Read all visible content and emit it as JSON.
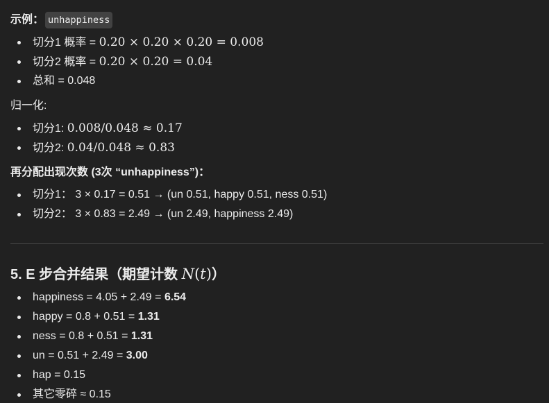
{
  "example": {
    "label": "示例：",
    "code": "unhappiness",
    "items": [
      {
        "prefix": "切分1 概率 = ",
        "math": "0.20 × 0.20 × 0.20 = 0.008"
      },
      {
        "prefix": "切分2 概率 = ",
        "math": "0.20 × 0.20 = 0.04"
      },
      {
        "text": "总和 = 0.048"
      }
    ]
  },
  "normalize": {
    "title": "归一化:",
    "items": [
      {
        "prefix": "切分1: ",
        "math": "0.008/0.048 ≈ 0.17"
      },
      {
        "prefix": "切分2: ",
        "math": "0.04/0.048 ≈ 0.83"
      }
    ]
  },
  "redistribute": {
    "title": "再分配出现次数 (3次 “unhappiness”)：",
    "items": [
      "切分1： 3 × 0.17 = 0.51 → (un 0.51, happy 0.51, ness 0.51)",
      "切分2： 3 × 0.83 = 2.49 → (un 2.49, happiness 2.49)"
    ]
  },
  "section5": {
    "title_text": "5. E 步合并结果（期望计数 ",
    "title_math_n": "N",
    "title_math_open": "(",
    "title_math_t": "t",
    "title_math_close": ")",
    "title_end": "）",
    "items": [
      {
        "text": "happiness = 4.05 + 2.49 = ",
        "bold": "6.54"
      },
      {
        "text": "happy = 0.8 + 0.51 = ",
        "bold": "1.31"
      },
      {
        "text": "ness = 0.8 + 0.51 = ",
        "bold": "1.31"
      },
      {
        "text": "un = 0.51 + 2.49 = ",
        "bold": "3.00"
      },
      {
        "text": "hap = 0.15",
        "bold": ""
      },
      {
        "text": "其它零碎 ≈ 0.15",
        "bold": ""
      }
    ]
  }
}
